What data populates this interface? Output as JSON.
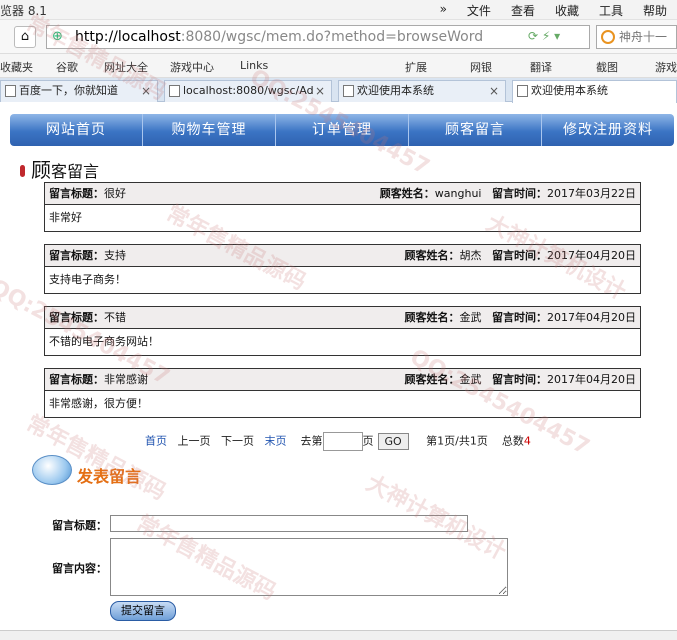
{
  "browser": {
    "app_title": "览器 8.1",
    "menus": [
      "»",
      "文件",
      "查看",
      "收藏",
      "工具",
      "帮助"
    ],
    "url_host": "http://localhost",
    "url_rest": ":8080/wgsc/mem.do?method=browseWord",
    "search_text": "神舟十一",
    "favorites": [
      "收藏夹",
      "谷歌",
      "网址大全",
      "游戏中心",
      "Links",
      "扩展",
      "网银",
      "翻译",
      "截图",
      "游戏"
    ],
    "tabs": [
      {
        "label": "百度一下，你就知道"
      },
      {
        "label": "localhost:8080/wgsc/Ad"
      },
      {
        "label": "欢迎使用本系统"
      },
      {
        "label": "欢迎使用本系统"
      }
    ]
  },
  "nav": [
    "网站首页",
    "购物车管理",
    "订单管理",
    "顾客留言",
    "修改注册资料"
  ],
  "section": {
    "title_big": "顾",
    "title_rest": "客留言"
  },
  "messages": {
    "title_label": "留言标题：",
    "name_label": "顾客姓名：",
    "time_label": "留言时间：",
    "items": [
      {
        "title": "很好",
        "name": "wanghui",
        "time": "2017年03月22日",
        "content": "非常好"
      },
      {
        "title": "支持",
        "name": "胡杰",
        "time": "2017年04月20日",
        "content": "支持电子商务！"
      },
      {
        "title": "不错",
        "name": "金武",
        "time": "2017年04月20日",
        "content": "不错的电子商务网站！"
      },
      {
        "title": "非常感谢",
        "name": "金武",
        "time": "2017年04月20日",
        "content": "非常感谢，很方便！"
      }
    ]
  },
  "pager": {
    "first": "首页",
    "prev": "上一页",
    "next": "下一页",
    "last": "末页",
    "goto_prefix": "去第",
    "goto_suffix": "页",
    "go": "GO",
    "page_info": "第1页/共1页",
    "total_label": "总数",
    "total": "4"
  },
  "post": {
    "heading": "发表留言",
    "title_label": "留言标题：",
    "content_label": "留言内容：",
    "submit": "提交留言"
  },
  "watermarks": [
    "常年售精品源码",
    "QQ:2545404457",
    "大神计算机设计"
  ]
}
